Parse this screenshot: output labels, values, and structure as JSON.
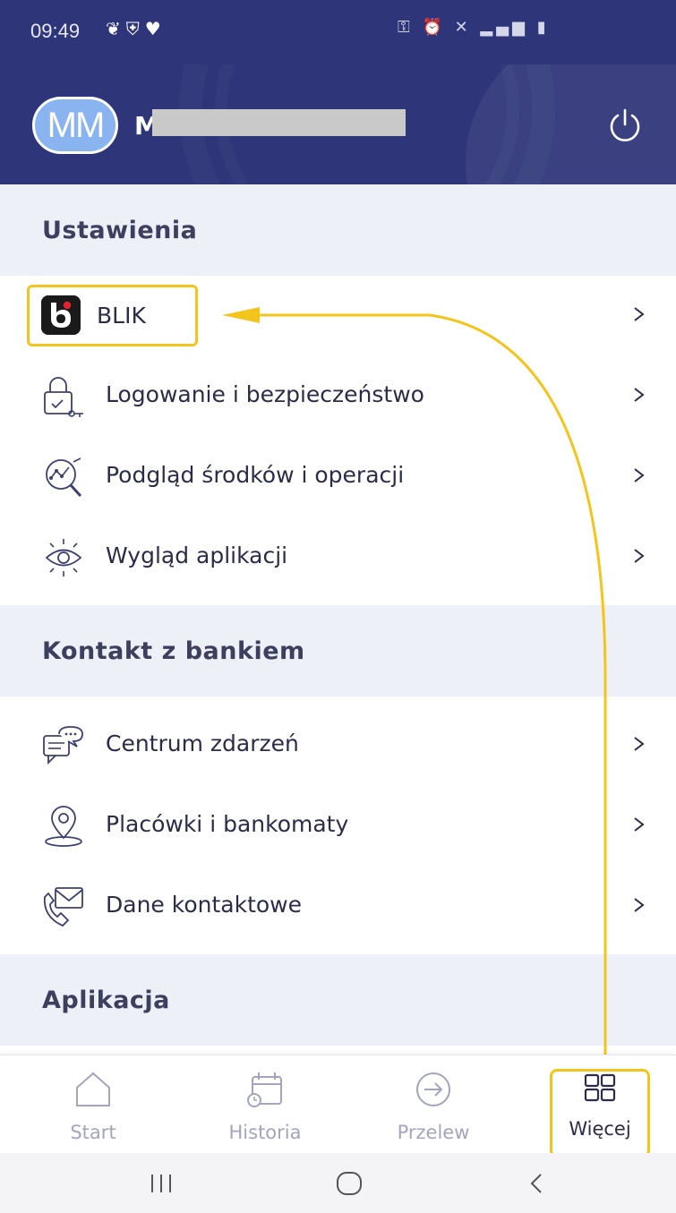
{
  "status_bar": {
    "time": "09:49",
    "left_icons": [
      "leaf-notification-icon",
      "shield-notification-icon",
      "heart-notification-icon"
    ],
    "right_icons": [
      "vpn-key-icon",
      "alarm-icon",
      "mute-icon",
      "signal-icon",
      "lte-icon",
      "signal-icon",
      "battery-icon"
    ]
  },
  "header": {
    "avatar_initials": "MM",
    "user_name": "M                                   N"
  },
  "sections": [
    {
      "title": "Ustawienia",
      "items": [
        {
          "label": "BLIK",
          "icon": "blik-icon"
        },
        {
          "label": "Logowanie i bezpieczeństwo",
          "icon": "lock-key-icon"
        },
        {
          "label": "Podgląd środków i operacji",
          "icon": "magnifier-chart-icon"
        },
        {
          "label": "Wygląd aplikacji",
          "icon": "eye-icon"
        }
      ]
    },
    {
      "title": "Kontakt z bankiem",
      "items": [
        {
          "label": "Centrum zdarzeń",
          "icon": "chat-bubbles-icon"
        },
        {
          "label": "Placówki i bankomaty",
          "icon": "location-pin-icon"
        },
        {
          "label": "Dane kontaktowe",
          "icon": "phone-envelope-icon"
        }
      ]
    },
    {
      "title": "Aplikacja",
      "items": []
    }
  ],
  "bottom_nav": [
    {
      "label": "Start",
      "icon": "home-icon",
      "active": false
    },
    {
      "label": "Historia",
      "icon": "calendar-history-icon",
      "active": false
    },
    {
      "label": "Przelew",
      "icon": "arrow-circle-icon",
      "active": false
    },
    {
      "label": "Więcej",
      "icon": "grid-icon",
      "active": true
    }
  ],
  "colors": {
    "header_bg": "#2e3579",
    "section_bg": "#eef0f8",
    "highlight": "#f3c51c",
    "text": "#2b2d48",
    "nav_inactive": "#a3a5bd",
    "blik_red": "#e4242a"
  }
}
